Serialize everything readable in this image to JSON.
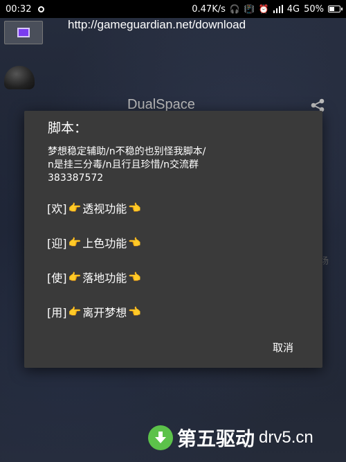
{
  "status_bar": {
    "time": "00:32",
    "speed": "0.47K/s",
    "network": "4G",
    "battery": "50%"
  },
  "overlay": {
    "url": "http://gameguardian.net/download"
  },
  "background_app": {
    "title": "DualSpace",
    "side_char": "场"
  },
  "dialog": {
    "title": "脚本：",
    "message": "梦想稳定辅助/n不稳的也别怪我脚本/\nn是挂三分毒/n且行且珍惜/n交流群\n383387572",
    "options": [
      {
        "prefix": "[欢]",
        "label": "透视功能"
      },
      {
        "prefix": "[迎]",
        "label": "上色功能"
      },
      {
        "prefix": "[使]",
        "label": "落地功能"
      },
      {
        "prefix": "[用]",
        "label": "离开梦想"
      }
    ],
    "cancel_label": "取消"
  },
  "watermark": {
    "text": "第五驱动",
    "domain": "drv5.cn"
  },
  "colors": {
    "dialog_bg": "#3a3a3a",
    "hand_emoji": "#f5b833",
    "float_icon": "#7a3cf0",
    "watermark_green": "#5cc24a"
  }
}
